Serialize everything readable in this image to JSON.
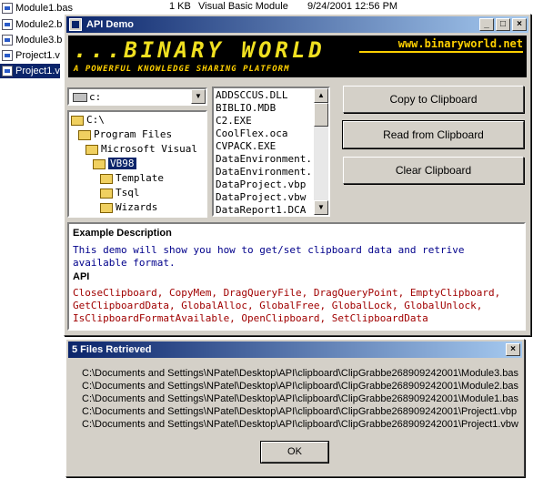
{
  "background_explorer": {
    "files": [
      {
        "name": "Module1.bas"
      },
      {
        "name": "Module2.b"
      },
      {
        "name": "Module3.b"
      },
      {
        "name": "Project1.v"
      },
      {
        "name": "Project1.v"
      }
    ],
    "row_size": "1 KB",
    "row_type": "Visual Basic Module",
    "row_date": "9/24/2001 12:56 PM"
  },
  "window": {
    "title": "API Demo",
    "controls": {
      "minimize": "_",
      "maximize": "□",
      "close": "×"
    },
    "banner": {
      "logo": "...BINARY WORLD",
      "tagline": "A POWERFUL KNOWLEDGE SHARING PLATFORM",
      "url": "www.binaryworld.net"
    },
    "drive": {
      "value": "c:",
      "arrow": "▼"
    },
    "dirs": [
      {
        "label": "C:\\",
        "indent": 0
      },
      {
        "label": "Program Files",
        "indent": 1
      },
      {
        "label": "Microsoft Visual",
        "indent": 2
      },
      {
        "label": "VB98",
        "indent": 3,
        "selected": true
      },
      {
        "label": "Template",
        "indent": 4
      },
      {
        "label": "Tsql",
        "indent": 4
      },
      {
        "label": "Wizards",
        "indent": 4
      }
    ],
    "files": [
      "ADDSCCUS.DLL",
      "BIBLIO.MDB",
      "C2.EXE",
      "CoolFlex.oca",
      "CVPACK.EXE",
      "DataEnvironment.",
      "DataEnvironment.",
      "DataProject.vbp",
      "DataProject.vbw",
      "DataReport1.DCA"
    ],
    "scroll_arrows": {
      "up": "▲",
      "down": "▼"
    },
    "buttons": {
      "copy": "Copy to Clipboard",
      "read": "Read from Clipboard",
      "clear": "Clear Clipboard"
    },
    "description": {
      "heading": "Example Description",
      "text": "This demo will show you how to get/set clipboard data and retrive available format.",
      "api_heading": "API",
      "api_text": "CloseClipboard, CopyMem, DragQueryFile, DragQueryPoint, EmptyClipboard, GetClipboardData, GlobalAlloc, GlobalFree, GlobalLock, GlobalUnlock, IsClipboardFormatAvailable, OpenClipboard, SetClipboardData"
    }
  },
  "dialog": {
    "title": "5 Files Retrieved",
    "close": "×",
    "lines": [
      "C:\\Documents and Settings\\NPatel\\Desktop\\API\\clipboard\\ClipGrabbe268909242001\\Module3.bas",
      "C:\\Documents and Settings\\NPatel\\Desktop\\API\\clipboard\\ClipGrabbe268909242001\\Module2.bas",
      "C:\\Documents and Settings\\NPatel\\Desktop\\API\\clipboard\\ClipGrabbe268909242001\\Module1.bas",
      "C:\\Documents and Settings\\NPatel\\Desktop\\API\\clipboard\\ClipGrabbe268909242001\\Project1.vbp",
      "C:\\Documents and Settings\\NPatel\\Desktop\\API\\clipboard\\ClipGrabbe268909242001\\Project1.vbw"
    ],
    "ok_label": "OK"
  }
}
